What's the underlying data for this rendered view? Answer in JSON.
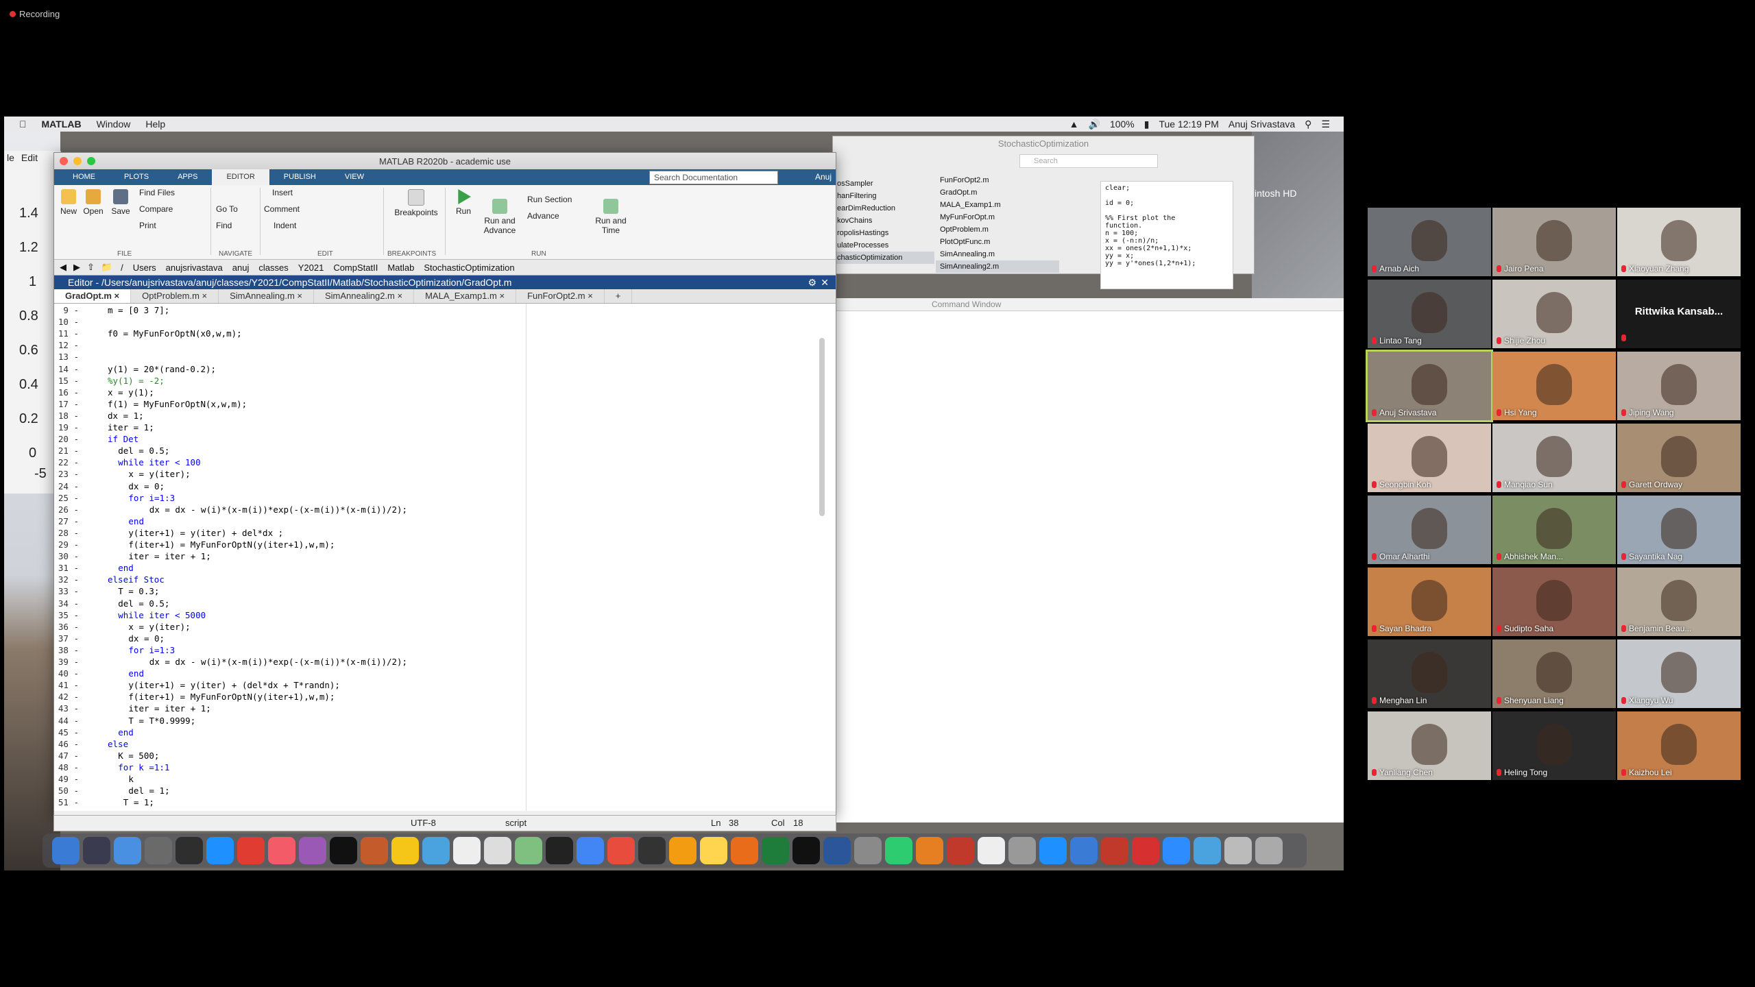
{
  "recording": {
    "label": "Recording"
  },
  "menubar": {
    "app": "MATLAB",
    "items": [
      "Window",
      "Help"
    ],
    "battery": "100%",
    "clock": "Tue 12:19 PM",
    "user": "Anuj Srivastava"
  },
  "plot": {
    "yticks": [
      "1.4",
      "1.2",
      "1",
      "0.8",
      "0.6",
      "0.4",
      "0.2",
      "0",
      "-5"
    ],
    "menu": [
      "le",
      "Edit"
    ]
  },
  "matlab": {
    "title": "MATLAB R2020b - academic use",
    "tabs": [
      "HOME",
      "PLOTS",
      "APPS",
      "EDITOR",
      "PUBLISH",
      "VIEW"
    ],
    "active_tab": "EDITOR",
    "search_placeholder": "Search Documentation",
    "user": "Anuj",
    "ribbon": {
      "new": "New",
      "open": "Open",
      "save": "Save",
      "find_files": "Find Files",
      "compare": "Compare",
      "print": "Print",
      "go_to": "Go To",
      "find": "Find",
      "insert": "Insert",
      "comment": "Comment",
      "indent": "Indent",
      "breakpoints": "Breakpoints",
      "run": "Run",
      "run_and_advance": "Run and\nAdvance",
      "run_section": "Run Section",
      "advance": "Advance",
      "run_and_time": "Run and\nTime",
      "sections": [
        "FILE",
        "NAVIGATE",
        "EDIT",
        "BREAKPOINTS",
        "RUN"
      ]
    },
    "path": [
      "/",
      "Users",
      "anujsrivastava",
      "anuj",
      "classes",
      "Y2021",
      "CompStatII",
      "Matlab",
      "StochasticOptimization"
    ],
    "editor_title": "Editor - /Users/anujsrivastava/anuj/classes/Y2021/CompStatII/Matlab/StochasticOptimization/GradOpt.m",
    "file_tabs": [
      "GradOpt.m",
      "OptProblem.m",
      "SimAnnealing.m",
      "SimAnnealing2.m",
      "MALA_Examp1.m",
      "FunForOpt2.m",
      "+"
    ],
    "code": [
      {
        "n": "9",
        "t": "m = [0 3 7];",
        "i": 0
      },
      {
        "n": "10",
        "t": "",
        "i": 0
      },
      {
        "n": "11",
        "t": "f0 = MyFunForOptN(x0,w,m);",
        "i": 0
      },
      {
        "n": "12",
        "t": "",
        "i": 0
      },
      {
        "n": "13",
        "t": "",
        "i": 0
      },
      {
        "n": "14",
        "t": "y(1) = 20*(rand-0.2);",
        "i": 0
      },
      {
        "n": "15",
        "t": "%y(1) = -2;",
        "i": 0,
        "c": "comment"
      },
      {
        "n": "16",
        "t": "x = y(1);",
        "i": 0
      },
      {
        "n": "17",
        "t": "f(1) = MyFunForOptN(x,w,m);",
        "i": 0
      },
      {
        "n": "18",
        "t": "dx = 1;",
        "i": 0
      },
      {
        "n": "19",
        "t": "iter = 1;",
        "i": 0
      },
      {
        "n": "20",
        "t": "if Det",
        "i": 0,
        "c": "kw"
      },
      {
        "n": "21",
        "t": "del = 0.5;",
        "i": 2
      },
      {
        "n": "22",
        "t": "while iter < 100",
        "i": 2,
        "c": "kw"
      },
      {
        "n": "23",
        "t": "x = y(iter);",
        "i": 4
      },
      {
        "n": "24",
        "t": "dx = 0;",
        "i": 4
      },
      {
        "n": "25",
        "t": "for i=1:3",
        "i": 4,
        "c": "kw"
      },
      {
        "n": "26",
        "t": "dx = dx - w(i)*(x-m(i))*exp(-(x-m(i))*(x-m(i))/2);",
        "i": 8
      },
      {
        "n": "27",
        "t": "end",
        "i": 4,
        "c": "kw"
      },
      {
        "n": "28",
        "t": "y(iter+1) = y(iter) + del*dx ;",
        "i": 4
      },
      {
        "n": "29",
        "t": "f(iter+1) = MyFunForOptN(y(iter+1),w,m);",
        "i": 4
      },
      {
        "n": "30",
        "t": "iter = iter + 1;",
        "i": 4
      },
      {
        "n": "31",
        "t": "end",
        "i": 2,
        "c": "kw"
      },
      {
        "n": "32",
        "t": "elseif Stoc",
        "i": 0,
        "c": "kw"
      },
      {
        "n": "33",
        "t": "T = 0.3;",
        "i": 2
      },
      {
        "n": "34",
        "t": "del = 0.5;",
        "i": 2
      },
      {
        "n": "35",
        "t": "while iter < 5000",
        "i": 2,
        "c": "kw"
      },
      {
        "n": "36",
        "t": "x = y(iter);",
        "i": 4
      },
      {
        "n": "37",
        "t": "dx = 0;",
        "i": 4
      },
      {
        "n": "38",
        "t": "for i=1:3",
        "i": 4,
        "c": "kw"
      },
      {
        "n": "39",
        "t": "dx = dx - w(i)*(x-m(i))*exp(-(x-m(i))*(x-m(i))/2);",
        "i": 8
      },
      {
        "n": "40",
        "t": "end",
        "i": 4,
        "c": "kw"
      },
      {
        "n": "41",
        "t": "y(iter+1) = y(iter) + (del*dx + T*randn);",
        "i": 4
      },
      {
        "n": "42",
        "t": "f(iter+1) = MyFunForOptN(y(iter+1),w,m);",
        "i": 4
      },
      {
        "n": "43",
        "t": "iter = iter + 1;",
        "i": 4
      },
      {
        "n": "44",
        "t": "T = T*0.9999;",
        "i": 4
      },
      {
        "n": "45",
        "t": "end",
        "i": 2,
        "c": "kw"
      },
      {
        "n": "46",
        "t": "else",
        "i": 0,
        "c": "kw"
      },
      {
        "n": "47",
        "t": "K = 500;",
        "i": 2
      },
      {
        "n": "48",
        "t": "for k =1:1",
        "i": 2,
        "c": "kw"
      },
      {
        "n": "49",
        "t": "k",
        "i": 4
      },
      {
        "n": "50",
        "t": "del = 1;",
        "i": 4
      },
      {
        "n": "51",
        "t": "T = 1;",
        "i": 3
      }
    ],
    "statusbar": {
      "encoding": "UTF-8",
      "type": "script",
      "ln_label": "Ln",
      "ln": "38",
      "col_label": "Col",
      "col": "18"
    },
    "command_window": "Command Window"
  },
  "finder": {
    "title": "StochasticOptimization",
    "search": "Search",
    "col1": [
      "osSampler",
      "hanFiltering",
      "earDimReduction",
      "kovChains",
      "ropolisHastings",
      "ulateProcesses",
      "chasticOptimization"
    ],
    "col2": [
      "FunForOpt2.m",
      "GradOpt.m",
      "MALA_Examp1.m",
      "MyFunForOpt.m",
      "OptProblem.m",
      "PlotOptFunc.m",
      "SimAnnealing.m",
      "SimAnnealing2.m"
    ],
    "preview": "clear;\n\nid = 0;\n\n%% First plot the\nfunction.\nn = 100;\nx = (-n:n)/n;\nxx = ones(2*n+1,1)*x;\nyy = x;\nyy = y'*ones(1,2*n+1);",
    "desktop_label": "intosh HD"
  },
  "participants": [
    {
      "name": "Arnab Aich",
      "bg": "#6c6f74"
    },
    {
      "name": "Jairo Pena",
      "bg": "#a79f95"
    },
    {
      "name": "Xiaoyuan Zhang",
      "bg": "#d9d5cf"
    },
    {
      "name": "Lintao Tang",
      "bg": "#595a5c"
    },
    {
      "name": "Shijie Zhou",
      "bg": "#c9c4bd"
    },
    {
      "name": "Rittwika Kansab...",
      "bg": "#1a1a1a",
      "textonly": true
    },
    {
      "name": "Anuj Srivastava",
      "bg": "#8d8276",
      "active": true
    },
    {
      "name": "Hsi Yang",
      "bg": "#d2874e"
    },
    {
      "name": "Jiping Wang",
      "bg": "#b8aca2"
    },
    {
      "name": "Seongbin Koh",
      "bg": "#d8c4b8"
    },
    {
      "name": "Manqiao Sun",
      "bg": "#c9c6c4"
    },
    {
      "name": "Garett Ordway",
      "bg": "#a88f74"
    },
    {
      "name": "Omar Alharthi",
      "bg": "#8b929a"
    },
    {
      "name": "Abhishek Man...",
      "bg": "#7b8e63"
    },
    {
      "name": "Sayantika Nag",
      "bg": "#9aa6b3"
    },
    {
      "name": "Sayan Bhadra",
      "bg": "#c68149"
    },
    {
      "name": "Sudipto Saha",
      "bg": "#8c5a4c"
    },
    {
      "name": "Benjamin Beau...",
      "bg": "#b3a898"
    },
    {
      "name": "Menghan Lin",
      "bg": "#3a3836"
    },
    {
      "name": "Shenyuan Liang",
      "bg": "#8d7d6b"
    },
    {
      "name": "Xiangyu Wu",
      "bg": "#c4c7cb"
    },
    {
      "name": "Yanliang Chen",
      "bg": "#c7c3bd"
    },
    {
      "name": "Heling Tong",
      "bg": "#2a2a2a"
    },
    {
      "name": "Kaizhou Lei",
      "bg": "#c47e49"
    }
  ]
}
